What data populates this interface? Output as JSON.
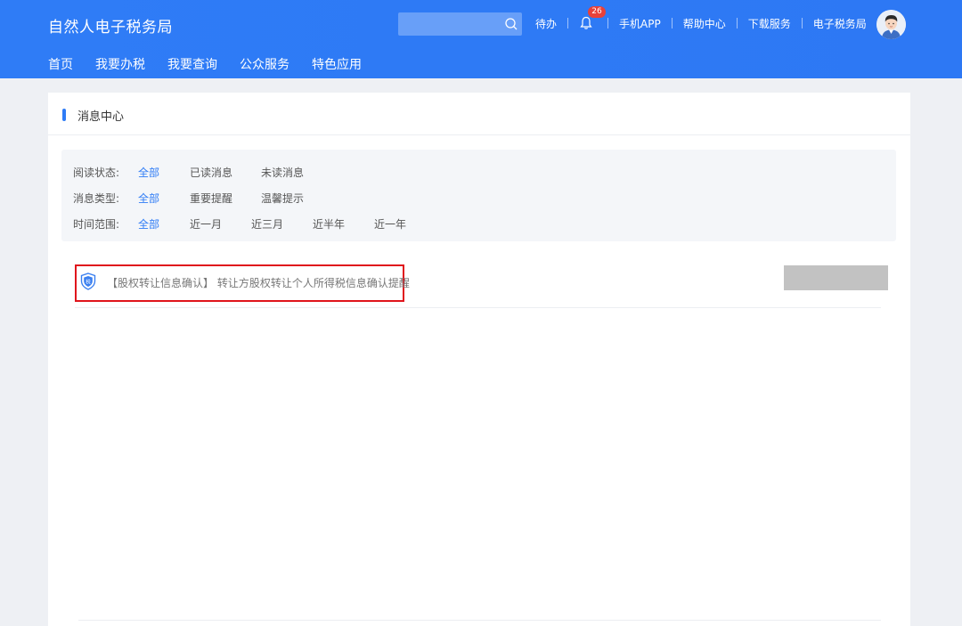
{
  "header": {
    "brand": "自然人电子税务局",
    "search_placeholder": "",
    "top_links": {
      "todo": "待办",
      "notification_count": "26",
      "mobile_app": "手机APP",
      "help": "帮助中心",
      "download": "下载服务",
      "e_tax": "电子税务局"
    },
    "nav": [
      "首页",
      "我要办税",
      "我要查询",
      "公众服务",
      "特色应用"
    ]
  },
  "page": {
    "title": "消息中心"
  },
  "filters": {
    "read_status": {
      "label": "阅读状态:",
      "options": [
        "全部",
        "已读消息",
        "未读消息"
      ],
      "selected": "全部"
    },
    "message_type": {
      "label": "消息类型:",
      "options": [
        "全部",
        "重要提醒",
        "温馨提示"
      ],
      "selected": "全部"
    },
    "time_range": {
      "label": "时间范围:",
      "options": [
        "全部",
        "近一月",
        "近三月",
        "近半年",
        "近一年"
      ],
      "selected": "全部"
    }
  },
  "messages": [
    {
      "icon": "shield-icon",
      "icon_char": "税",
      "text": "【股权转让信息确认】 转让方股权转让个人所得税信息确认提醒",
      "action_label": ""
    }
  ],
  "colors": {
    "header_bg": "#2f7cf6",
    "accent": "#2f7cf6",
    "badge": "#e8413a",
    "highlight_border": "#e0141c"
  }
}
